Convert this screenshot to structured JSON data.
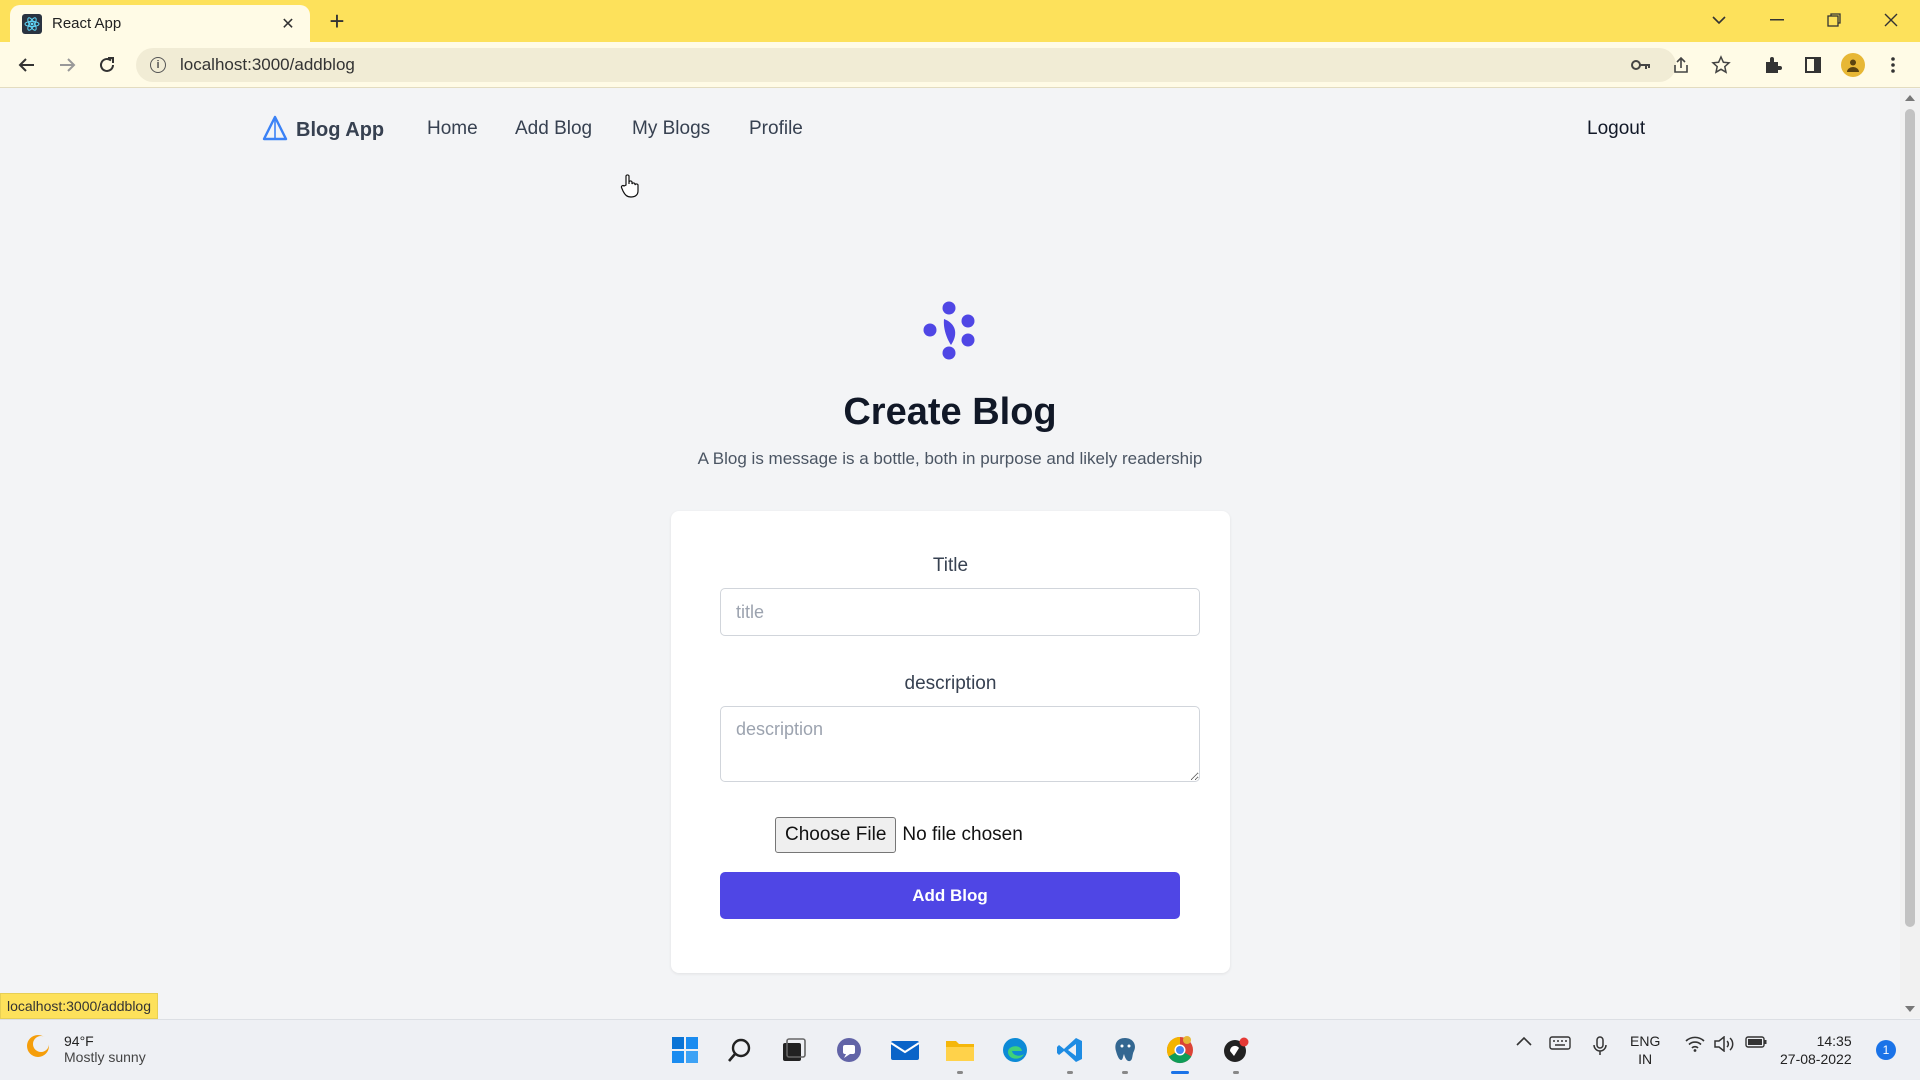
{
  "browser": {
    "tab_title": "React App",
    "url": "localhost:3000/addblog",
    "status_url": "localhost:3000/addblog"
  },
  "navbar": {
    "brand": "Blog App",
    "links": [
      "Home",
      "Add Blog",
      "My Blogs",
      "Profile"
    ],
    "logout": "Logout"
  },
  "main": {
    "heading": "Create Blog",
    "subtitle": "A Blog is message is a bottle, both in purpose and likely readership"
  },
  "form": {
    "title_label": "Title",
    "title_placeholder": "title",
    "description_label": "description",
    "description_placeholder": "description",
    "file_button": "Choose File",
    "file_status": "No file chosen",
    "submit_label": "Add Blog"
  },
  "taskbar": {
    "weather_temp": "94°F",
    "weather_desc": "Mostly sunny",
    "lang_line1": "ENG",
    "lang_line2": "IN",
    "time": "14:35",
    "date": "27-08-2022",
    "notification_count": "1"
  },
  "colors": {
    "accent": "#4f46e5",
    "chrome": "#fde15b"
  }
}
